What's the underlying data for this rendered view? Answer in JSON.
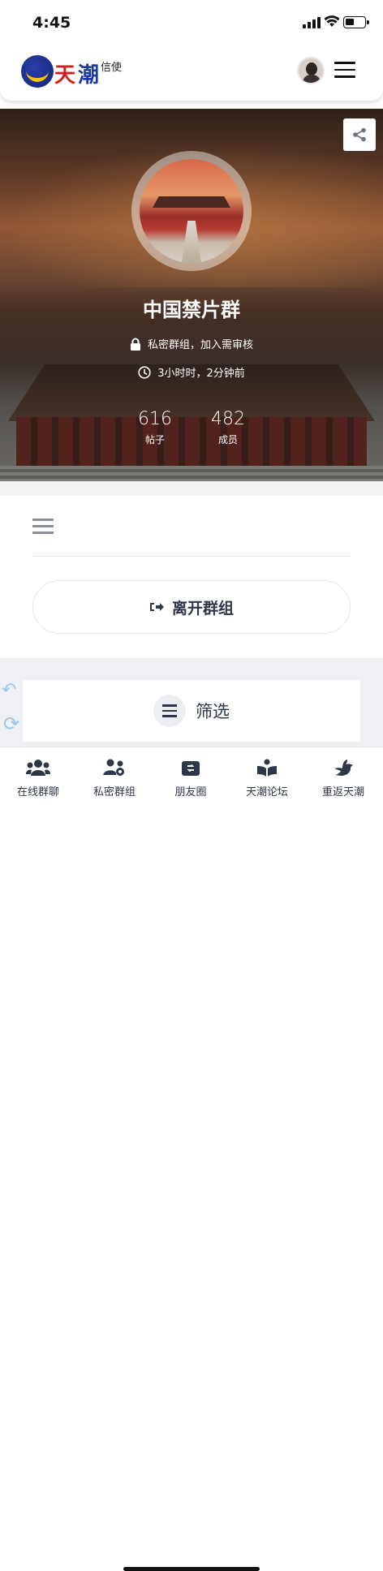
{
  "status_bar": {
    "time": "4:45"
  },
  "header": {
    "logo_brand": "天潮",
    "logo_sub": "信使"
  },
  "group": {
    "name": "中国禁片群",
    "privacy": "私密群组，加入需审核",
    "last_active": "3小时时，2分钟前",
    "stats": [
      {
        "value": "616",
        "label": "帖子"
      },
      {
        "value": "482",
        "label": "成员"
      }
    ]
  },
  "actions": {
    "leave_label": "离开群组",
    "filter_label": "筛选"
  },
  "tabbar": {
    "items": [
      {
        "label": "在线群聊",
        "icon": "users-icon"
      },
      {
        "label": "私密群组",
        "icon": "users-cog-icon"
      },
      {
        "label": "朋友圈",
        "icon": "camera-retro-icon"
      },
      {
        "label": "天潮论坛",
        "icon": "book-open-icon"
      },
      {
        "label": "重返天潮",
        "icon": "dove-icon"
      }
    ]
  }
}
